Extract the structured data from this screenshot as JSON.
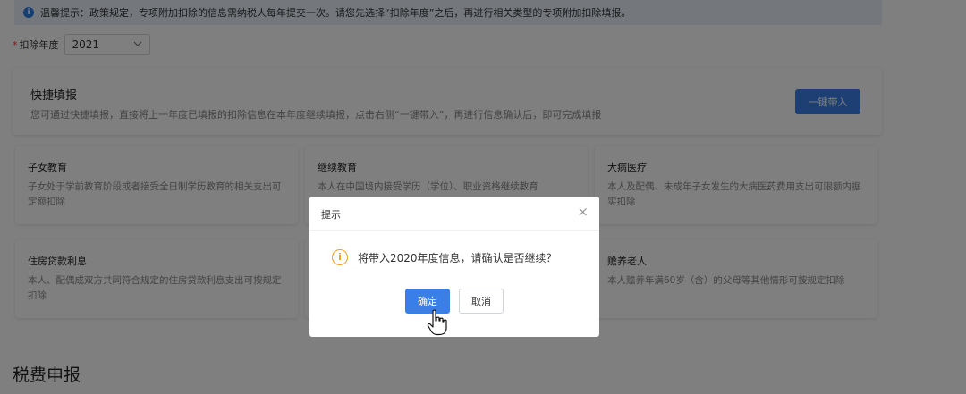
{
  "notice": {
    "text": "温馨提示：政策规定，专项附加扣除的信息需纳税人每年提交一次。请您先选择“扣除年度”之后，再进行相关类型的专项附加扣除填报。"
  },
  "year": {
    "required_mark": "*",
    "label": "扣除年度",
    "value": "2021"
  },
  "quick_fill": {
    "title": "快捷填报",
    "description": "您可通过快捷填报，直接将上一年度已填报的扣除信息在本年度继续填报，点击右侧“一键带入”，再进行信息确认后，即可完成填报",
    "button_label": "一键带入"
  },
  "items": [
    {
      "title": "子女教育",
      "desc": "子女处于学前教育阶段或者接受全日制学历教育的相关支出可定额扣除"
    },
    {
      "title": "继续教育",
      "desc": "本人在中国境内接受学历（学位）、职业资格继续教育"
    },
    {
      "title": "大病医疗",
      "desc": "本人及配偶、未成年子女发生的大病医药费用支出可限额内据实扣除"
    },
    {
      "title": "住房贷款利息",
      "desc": "本人、配偶成双方共同符合规定的住房贷款利息支出可按规定扣除"
    },
    {
      "title": "",
      "desc": ""
    },
    {
      "title": "赡养老人",
      "desc": "本人赡养年满60岁（含）的父母等其他情形可按规定扣除"
    }
  ],
  "section": {
    "title": "税费申报"
  },
  "dialog": {
    "title": "提示",
    "close_glyph": "×",
    "warn_glyph": "i",
    "message": "将带入2020年度信息，请确认是否继续？",
    "ok_label": "确定",
    "cancel_label": "取消"
  },
  "colors": {
    "primary": "#3a7fe8",
    "warning": "#f0a020",
    "notice_bg": "#e8f0fb"
  }
}
